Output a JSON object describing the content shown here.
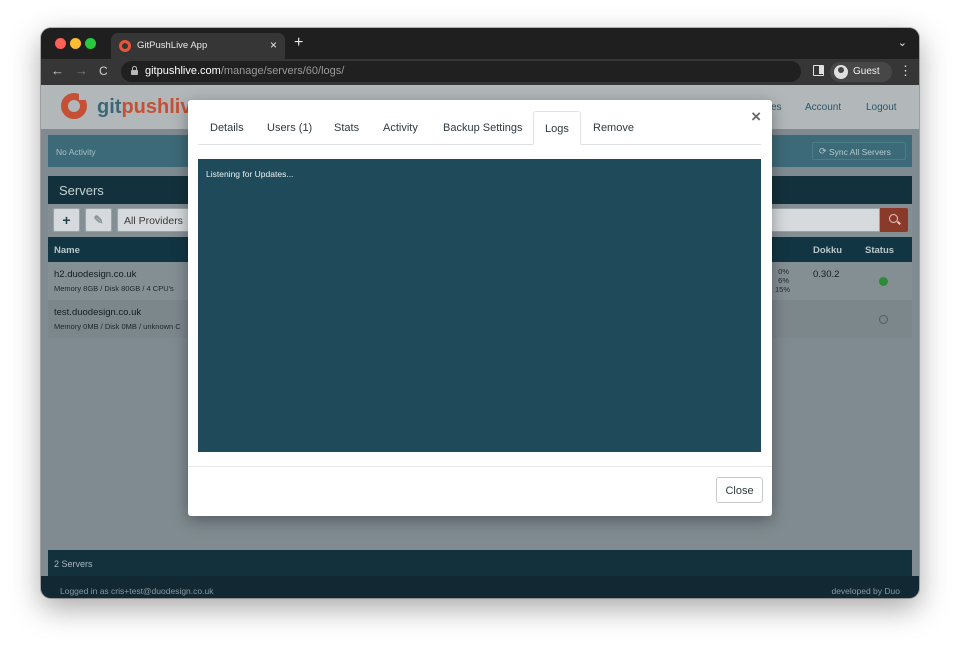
{
  "browser": {
    "tab_title": "GitPushLive App",
    "tab_close": "×",
    "new_tab": "+",
    "chevron": "⌄",
    "url_host": "gitpushlive.com",
    "url_path": "/manage/servers/60/logs/",
    "profile_label": "Guest",
    "kebab": "⋮",
    "back": "←",
    "forward": "→",
    "reload": "C"
  },
  "site": {
    "logo_part1": "git",
    "logo_part2": "pushliv",
    "nav": {
      "partial": "es",
      "account": "Account",
      "logout": "Logout"
    },
    "activity": {
      "text": "No Activity",
      "sync_icon": "⟳",
      "sync_label": "Sync All Servers"
    },
    "servers": {
      "title": "Servers",
      "add_glyph": "+",
      "edit_glyph": "✎",
      "provider_filter": "All Providers",
      "columns": {
        "name": "Name",
        "dokku": "Dokku",
        "status": "Status"
      },
      "rows": [
        {
          "name": "h2.duodesign.co.uk",
          "sub": "Memory 8GB / Disk 80GB / 4 CPU's",
          "stat1": "0%",
          "stat2": "6%",
          "stat3": "15%",
          "dokku": "0.30.2",
          "status": "online"
        },
        {
          "name": "test.duodesign.co.uk",
          "sub": "Memory 0MB / Disk 0MB / unknown C",
          "dokku": "",
          "status": "offline"
        }
      ],
      "count": "2 Servers"
    },
    "footer": {
      "left": "Logged in as cris+test@duodesign.co.uk",
      "right": "developed by Duo"
    }
  },
  "modal": {
    "close_x": "×",
    "tabs": [
      "Details",
      "Users (1)",
      "Stats",
      "Activity",
      "Backup Settings",
      "Logs",
      "Remove"
    ],
    "active_tab": "Logs",
    "log_text": "Listening for Updates...",
    "close_button": "Close"
  },
  "colors": {
    "brand_orange": "#c45135",
    "brand_teal": "#3c6777",
    "log_background": "#1e4a5a",
    "status_online": "#2d8a36"
  }
}
